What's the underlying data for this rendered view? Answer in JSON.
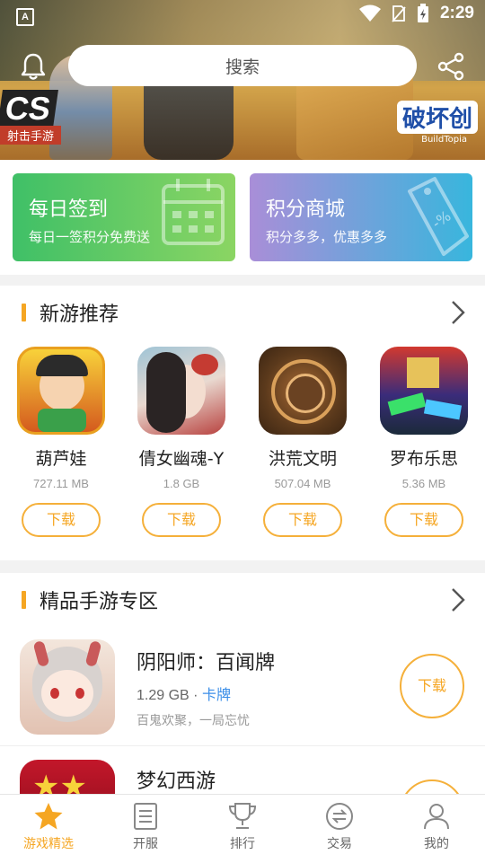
{
  "status_bar": {
    "time": "2:29"
  },
  "header": {
    "search_placeholder": "搜索"
  },
  "banner": {
    "left_logo": "CS",
    "left_sub": "射击手游",
    "right_logo": "破坏创",
    "right_sub": "BuildTopia"
  },
  "promo_cards": [
    {
      "title": "每日签到",
      "subtitle": "每日一签积分免费送"
    },
    {
      "title": "积分商城",
      "subtitle": "积分多多，优惠多多"
    }
  ],
  "new_games": {
    "title": "新游推荐",
    "items": [
      {
        "name": "葫芦娃",
        "size": "727.11 MB",
        "button": "下载"
      },
      {
        "name": "倩女幽魂-Y",
        "size": "1.8 GB",
        "button": "下载"
      },
      {
        "name": "洪荒文明",
        "size": "507.04 MB",
        "button": "下载"
      },
      {
        "name": "罗布乐思",
        "size": "5.36 MB",
        "button": "下载"
      }
    ]
  },
  "featured": {
    "title": "精品手游专区",
    "items": [
      {
        "name": "阴阳师：百闻牌",
        "size": "1.29 GB",
        "sep": "·",
        "tag": "卡牌",
        "desc": "百鬼欢聚，一局忘忧",
        "button": "下载"
      },
      {
        "name": "梦幻西游"
      }
    ]
  },
  "tabs": [
    {
      "label": "游戏精选",
      "icon": "star-icon",
      "active": true
    },
    {
      "label": "开服",
      "icon": "document-icon",
      "active": false
    },
    {
      "label": "排行",
      "icon": "trophy-icon",
      "active": false
    },
    {
      "label": "交易",
      "icon": "exchange-icon",
      "active": false
    },
    {
      "label": "我的",
      "icon": "user-icon",
      "active": false
    }
  ],
  "colors": {
    "accent": "#f5a623",
    "tag_blue": "#3b8ee8"
  }
}
